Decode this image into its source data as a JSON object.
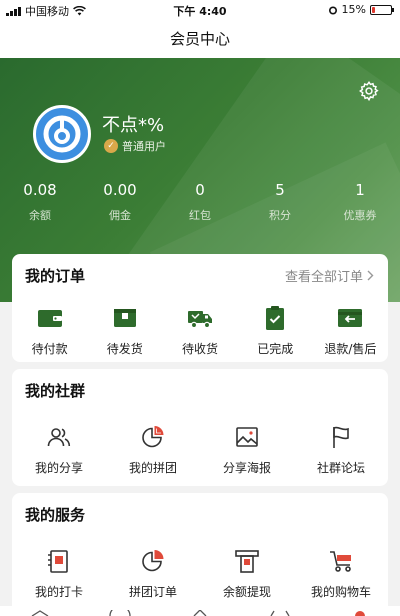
{
  "status_bar": {
    "carrier": "中国移动",
    "time": "下午 4:40",
    "battery": "15%",
    "battery_level": 0.15
  },
  "nav": {
    "title": "会员中心"
  },
  "profile": {
    "name": "不点*%",
    "level": "普通用户"
  },
  "stats": [
    {
      "value": "0.08",
      "label": "余额"
    },
    {
      "value": "0.00",
      "label": "佣金"
    },
    {
      "value": "0",
      "label": "红包"
    },
    {
      "value": "5",
      "label": "积分"
    },
    {
      "value": "1",
      "label": "优惠券"
    }
  ],
  "orders": {
    "title": "我的订单",
    "view_all": "查看全部订单",
    "items": [
      {
        "label": "待付款",
        "icon": "wallet-icon"
      },
      {
        "label": "待发货",
        "icon": "box-icon"
      },
      {
        "label": "待收货",
        "icon": "truck-icon"
      },
      {
        "label": "已完成",
        "icon": "clipboard-check-icon"
      },
      {
        "label": "退款/售后",
        "icon": "refund-icon"
      }
    ]
  },
  "community": {
    "title": "我的社群",
    "items": [
      {
        "label": "我的分享",
        "icon": "users-icon"
      },
      {
        "label": "我的拼团",
        "icon": "pie-icon"
      },
      {
        "label": "分享海报",
        "icon": "image-icon"
      },
      {
        "label": "社群论坛",
        "icon": "flag-icon"
      }
    ]
  },
  "services": {
    "title": "我的服务",
    "items": [
      {
        "label": "我的打卡",
        "icon": "checkin-icon"
      },
      {
        "label": "拼团订单",
        "icon": "pie-icon"
      },
      {
        "label": "余额提现",
        "icon": "withdraw-icon"
      },
      {
        "label": "我的购物车",
        "icon": "cart-icon"
      }
    ]
  },
  "colors": {
    "header_green": "#3b7d35",
    "icon_green": "#2e6b2c",
    "accent_red": "#e04a3a",
    "avatar_blue": "#3d8fe0"
  }
}
